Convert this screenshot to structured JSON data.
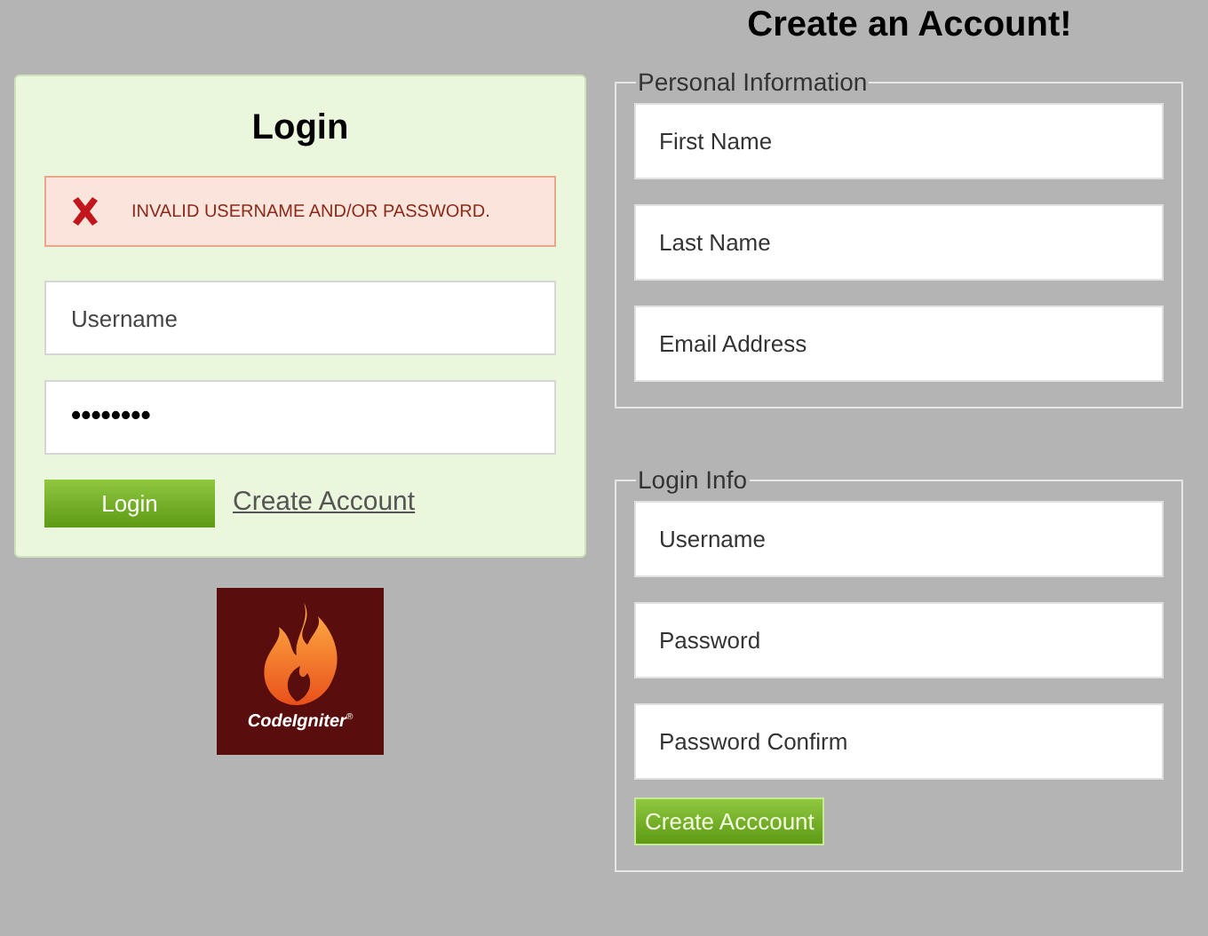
{
  "login": {
    "title": "Login",
    "error": "INVALID USERNAME AND/OR PASSWORD.",
    "fields": [
      {
        "placeholder": "Username"
      },
      {
        "value": "••••••••"
      }
    ],
    "button": "Login",
    "link": "Create Account"
  },
  "logo": {
    "text": "CodeIgniter",
    "mark": "®"
  },
  "signup": {
    "title": "Create an Account!",
    "sections": [
      {
        "legend": "Personal Information",
        "fields": [
          {
            "placeholder": "First Name"
          },
          {
            "placeholder": "Last Name"
          },
          {
            "placeholder": "Email Address"
          }
        ]
      },
      {
        "legend": "Login Info",
        "fields": [
          {
            "placeholder": "Username"
          },
          {
            "placeholder": "Password"
          },
          {
            "placeholder": "Password Confirm"
          }
        ],
        "button": "Create Acccount"
      }
    ]
  }
}
